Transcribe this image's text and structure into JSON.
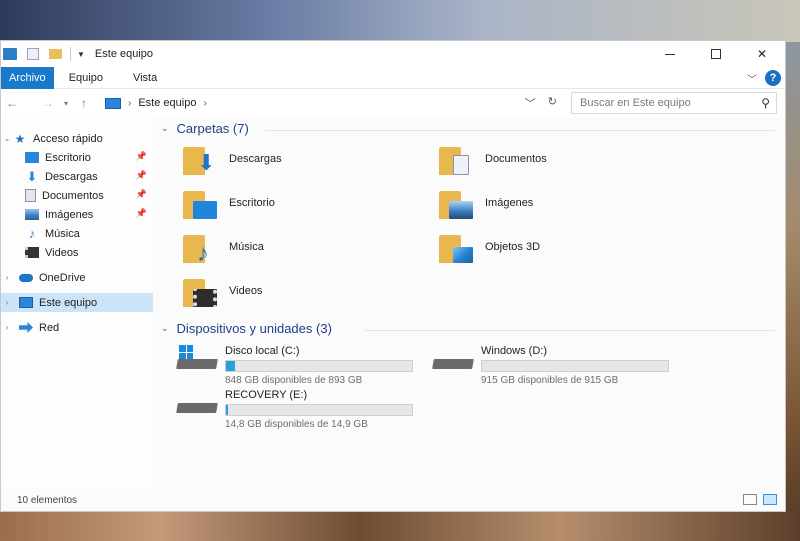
{
  "window": {
    "title": "Este equipo",
    "controls": {
      "minimize": "minimize-icon",
      "maximize": "maximize-icon",
      "close": "✕"
    }
  },
  "ribbon": {
    "tabs": [
      "Archivo",
      "Equipo",
      "Vista"
    ]
  },
  "address": {
    "crumbs": [
      "Este equipo"
    ],
    "search_placeholder": "Buscar en Este equipo"
  },
  "sidebar": {
    "quick_access": {
      "label": "Acceso rápido",
      "items": [
        {
          "label": "Escritorio",
          "icon": "desktop-icon",
          "pinned": true
        },
        {
          "label": "Descargas",
          "icon": "downloads-icon",
          "pinned": true
        },
        {
          "label": "Documentos",
          "icon": "documents-icon",
          "pinned": true
        },
        {
          "label": "Imágenes",
          "icon": "pictures-icon",
          "pinned": true
        },
        {
          "label": "Música",
          "icon": "music-icon",
          "pinned": false
        },
        {
          "label": "Videos",
          "icon": "videos-icon",
          "pinned": false
        }
      ]
    },
    "onedrive": "OneDrive",
    "this_pc": "Este equipo",
    "network": "Red"
  },
  "folders": {
    "header": "Carpetas (7)",
    "items": [
      {
        "label": "Descargas",
        "icon": "downloads-icon"
      },
      {
        "label": "Documentos",
        "icon": "documents-icon"
      },
      {
        "label": "Escritorio",
        "icon": "desktop-icon"
      },
      {
        "label": "Imágenes",
        "icon": "pictures-icon"
      },
      {
        "label": "Música",
        "icon": "music-icon"
      },
      {
        "label": "Objetos 3D",
        "icon": "3d-objects-icon"
      },
      {
        "label": "Videos",
        "icon": "videos-icon"
      }
    ]
  },
  "drives": {
    "header": "Dispositivos y unidades (3)",
    "items": [
      {
        "name": "Disco local (C:)",
        "free": "848 GB disponibles de 893 GB",
        "used_fraction": 0.05,
        "icon": "windows-drive-icon"
      },
      {
        "name": "Windows (D:)",
        "free": "915 GB disponibles de 915 GB",
        "used_fraction": 0.0,
        "icon": "drive-icon"
      },
      {
        "name": "RECOVERY (E:)",
        "free": "14,8 GB disponibles de 14,9 GB",
        "used_fraction": 0.01,
        "icon": "drive-icon"
      }
    ]
  },
  "status": {
    "count": "10 elementos"
  },
  "colors": {
    "accent": "#1979ca",
    "group_header": "#1e3f8a",
    "folder": "#e8b74e",
    "drive_bar": "#26a0da",
    "selection": "#cce4f7"
  }
}
